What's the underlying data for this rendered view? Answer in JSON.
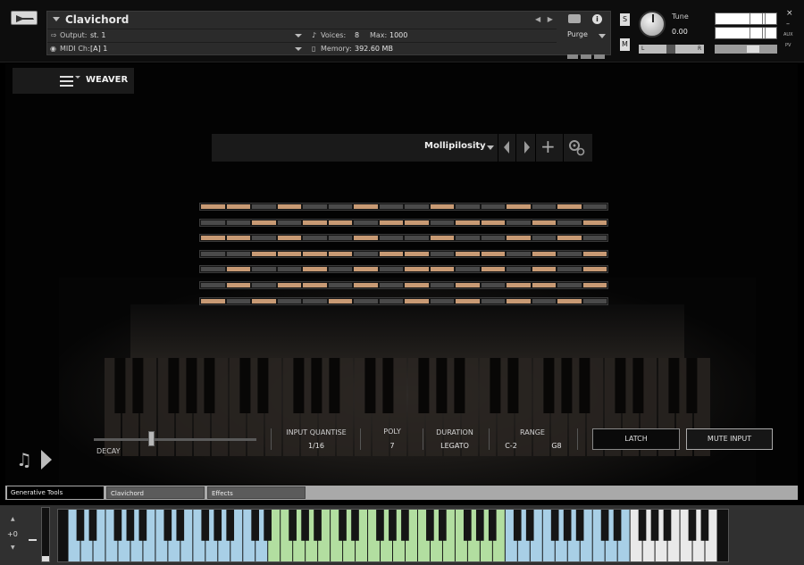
{
  "header": {
    "instrument_name": "Clavichord",
    "output_label": "Output:",
    "output_value": "st. 1",
    "midi_label": "MIDI Ch:",
    "midi_value": "[A]  1",
    "voices_label": "Voices:",
    "voices_value": "8",
    "max_label": "Max:",
    "max_value": "1000",
    "memory_label": "Memory:",
    "memory_value": "392.60 MB",
    "purge_label": "Purge",
    "info_label": "i",
    "s_label": "S",
    "m_label": "M",
    "tune_label": "Tune",
    "tune_value": "0.00",
    "pan_left": "L",
    "pan_right": "R",
    "close_label": "×",
    "minus_label": "–",
    "aux_label": "AUX",
    "pv_label": "PV"
  },
  "weaver": {
    "logo_text": "WEAVER",
    "preset_name": "Mollipilosity",
    "add_label": "+"
  },
  "sequencer": {
    "steps": 16,
    "on_color": "#c89a74",
    "off_color": "#4a4a4a",
    "rows": [
      [
        1,
        1,
        0,
        1,
        0,
        0,
        1,
        0,
        0,
        1,
        0,
        0,
        1,
        0,
        1,
        0
      ],
      [
        0,
        0,
        1,
        0,
        1,
        1,
        0,
        1,
        1,
        0,
        1,
        1,
        0,
        1,
        0,
        1
      ],
      [
        1,
        1,
        0,
        1,
        0,
        0,
        1,
        0,
        0,
        1,
        0,
        0,
        1,
        0,
        1,
        0
      ],
      [
        0,
        0,
        1,
        1,
        1,
        1,
        0,
        1,
        1,
        0,
        1,
        1,
        0,
        1,
        0,
        1
      ],
      [
        0,
        1,
        0,
        0,
        1,
        0,
        1,
        0,
        1,
        1,
        0,
        1,
        0,
        1,
        0,
        1
      ],
      [
        0,
        1,
        0,
        1,
        1,
        0,
        1,
        0,
        1,
        0,
        1,
        0,
        1,
        1,
        0,
        1
      ],
      [
        1,
        0,
        1,
        0,
        0,
        1,
        0,
        0,
        1,
        0,
        1,
        0,
        1,
        0,
        1,
        0
      ]
    ]
  },
  "controls": {
    "decay_label": "DECAY",
    "decay_level": 0.35,
    "input_quantise_label": "INPUT QUANTISE",
    "input_quantise_value": "1/16",
    "poly_label": "POLY",
    "poly_value": "7",
    "duration_label": "DURATION",
    "duration_value": "LEGATO",
    "range_label": "RANGE",
    "range_low": "C-2",
    "range_high": "G8",
    "latch_label": "LATCH",
    "mute_label": "MUTE INPUT",
    "note_icon": "♫"
  },
  "tabs": [
    {
      "label": "Generative Tools"
    },
    {
      "label": "Clavichord"
    },
    {
      "label": "Effects"
    }
  ],
  "keyboard": {
    "octave_value": "+0",
    "white_keys": 52,
    "blue_color": "#a8cfe6",
    "green_color": "#b2dea0",
    "white_color": "#e9e9e9",
    "blue_range_1": [
      0,
      16
    ],
    "green_range": [
      16,
      35
    ],
    "blue_range_2": [
      35,
      45
    ]
  }
}
